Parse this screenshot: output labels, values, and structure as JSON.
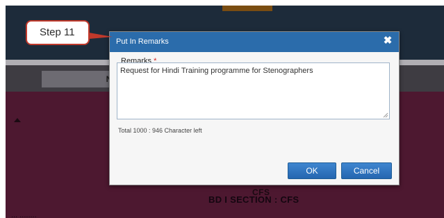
{
  "background": {
    "tab_label": "Na",
    "line1": "CFS",
    "line2": "BD I SECTION : CFS",
    "line3": "... ........"
  },
  "callout": {
    "label": "Step  11"
  },
  "modal": {
    "title": "Put In Remarks",
    "close_icon": "close-icon",
    "field_label": "Remarks",
    "required_mark": "*",
    "remarks_value": "Request for Hindi Training programme for Stenographers",
    "char_count": "Total 1000 : 946 Character left",
    "ok_label": "OK",
    "cancel_label": "Cancel"
  },
  "colors": {
    "title_bar": "#2b6cab",
    "button": "#2f74c0",
    "callout_border": "#c0392b",
    "app_body": "#4d1830"
  }
}
